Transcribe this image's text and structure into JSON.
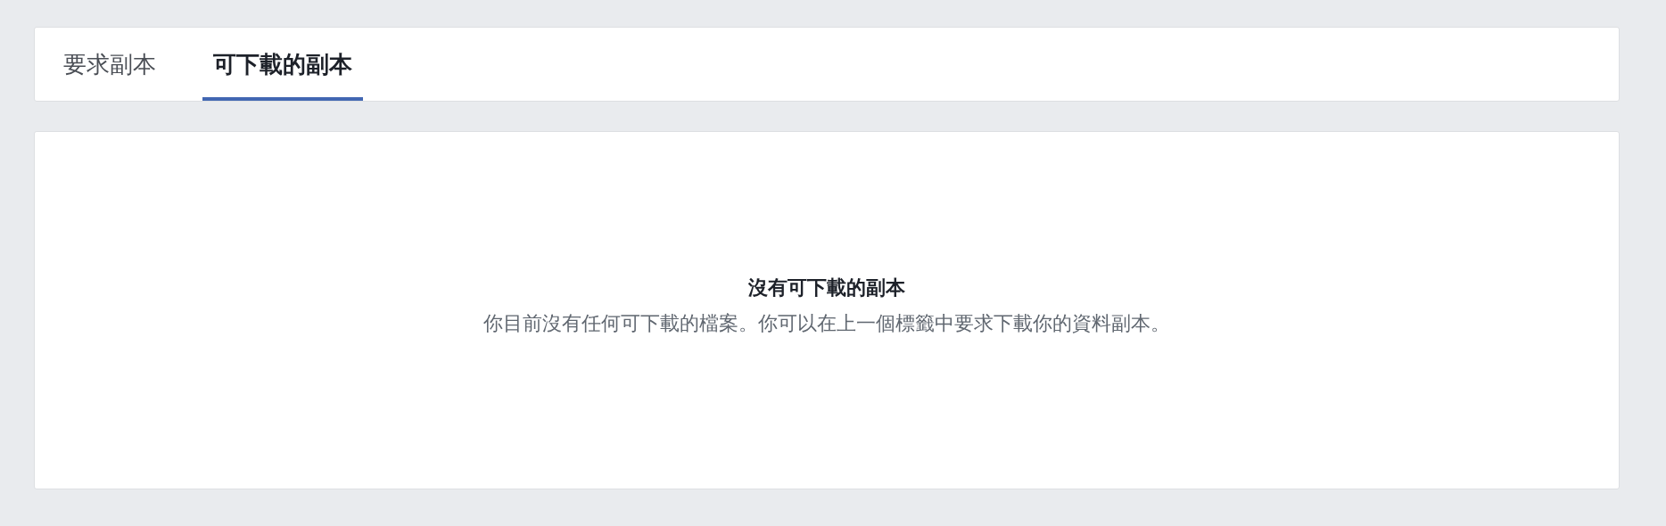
{
  "tabs": [
    {
      "label": "要求副本",
      "selected": false
    },
    {
      "label": "可下載的副本",
      "selected": true
    }
  ],
  "empty_state": {
    "title": "沒有可下載的副本",
    "message": "你目前沒有任何可下載的檔案。你可以在上一個標籤中要求下載你的資料副本。"
  }
}
